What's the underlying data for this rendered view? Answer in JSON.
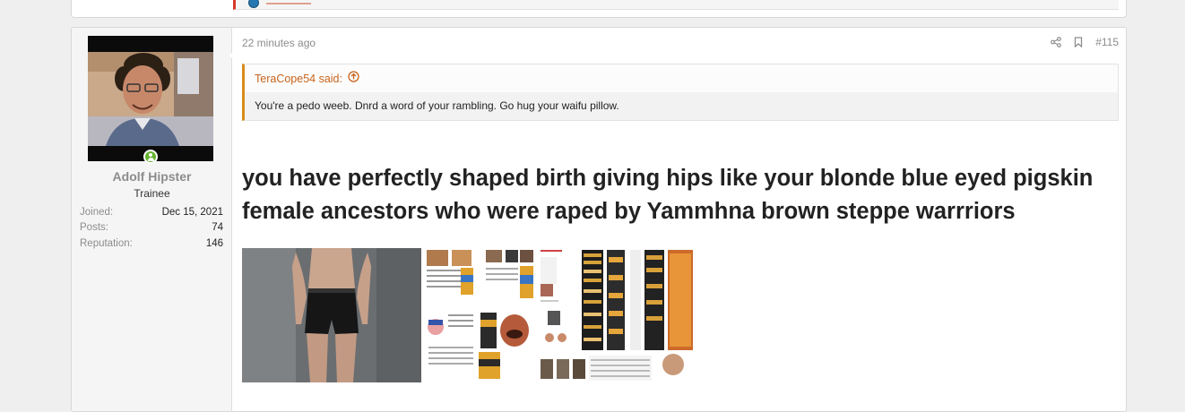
{
  "post": {
    "timestamp": "22 minutes ago",
    "post_number": "#115",
    "quote": {
      "author_label": "TeraCope54 said:",
      "text": "You're a pedo weeb. Dnrd a word of your rambling. Go hug your waifu pillow."
    },
    "headline": "you have perfectly shaped birth giving hips like your blonde blue eyed pigskin female ancestors who were raped by Yammhna brown steppe warrriors",
    "attachments": [
      {
        "name": "attachment-photo-torso"
      },
      {
        "name": "attachment-collage-faces"
      },
      {
        "name": "attachment-chart-table"
      }
    ]
  },
  "user": {
    "name": "Adolf Hipster",
    "title": "Trainee",
    "stats": [
      {
        "label": "Joined:",
        "value": "Dec 15, 2021"
      },
      {
        "label": "Posts:",
        "value": "74"
      },
      {
        "label": "Reputation:",
        "value": "146"
      }
    ]
  },
  "icons": {
    "share": "share-icon",
    "bookmark": "bookmark-icon",
    "quote_jump": "arrow-up-circle-icon",
    "online": "online-status-icon"
  },
  "colors": {
    "quote_border": "#d98c1a",
    "quote_author": "#c8641c",
    "online": "#63b32e"
  }
}
